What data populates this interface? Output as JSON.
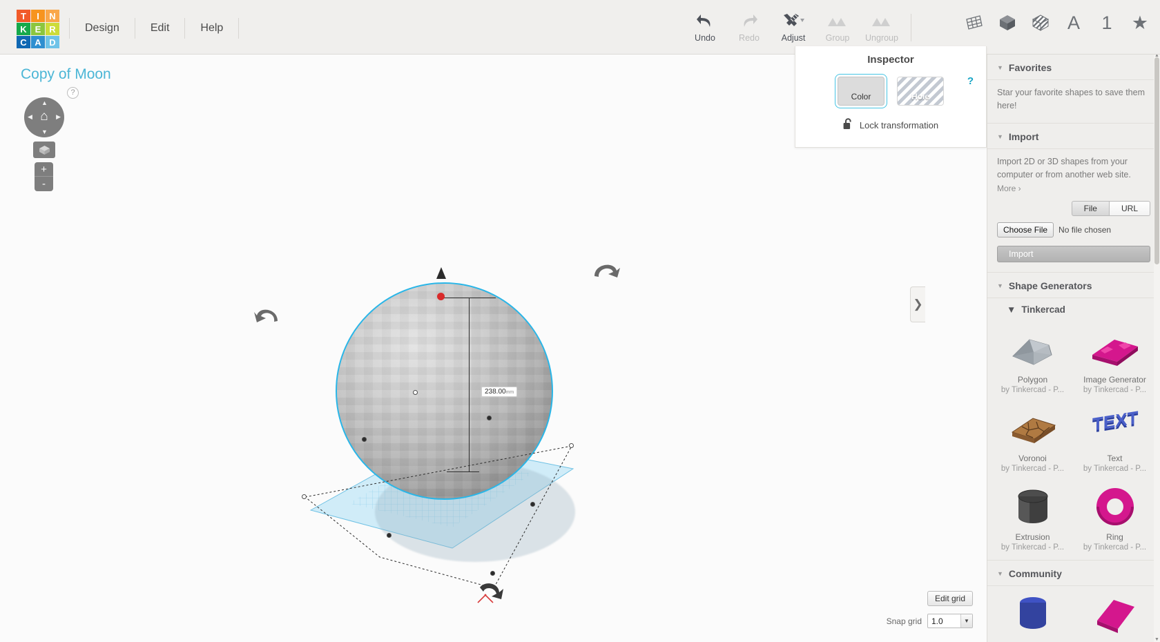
{
  "app": {
    "logo_letters": [
      {
        "ch": "T",
        "color": "#f15a29"
      },
      {
        "ch": "I",
        "color": "#f7941e"
      },
      {
        "ch": "N",
        "color": "#faa74a"
      },
      {
        "ch": "K",
        "color": "#16a94b"
      },
      {
        "ch": "E",
        "color": "#8cc63e"
      },
      {
        "ch": "R",
        "color": "#cddc39"
      },
      {
        "ch": "C",
        "color": "#1068b3"
      },
      {
        "ch": "A",
        "color": "#2f8fd0"
      },
      {
        "ch": "D",
        "color": "#6fc3e8"
      }
    ],
    "menu": [
      "Design",
      "Edit",
      "Help"
    ]
  },
  "toolbar": {
    "tools": [
      {
        "label": "Undo",
        "icon": "undo-icon",
        "disabled": false
      },
      {
        "label": "Redo",
        "icon": "redo-icon",
        "disabled": true
      },
      {
        "label": "Adjust",
        "icon": "adjust-icon",
        "disabled": false
      },
      {
        "label": "Group",
        "icon": "group-icon",
        "disabled": true
      },
      {
        "label": "Ungroup",
        "icon": "ungroup-icon",
        "disabled": true
      }
    ],
    "right_icons": [
      {
        "name": "workplane-icon",
        "glyph": ""
      },
      {
        "name": "solid-cube-icon",
        "glyph": ""
      },
      {
        "name": "hole-cube-icon",
        "glyph": ""
      },
      {
        "name": "text-a-icon",
        "glyph": "A"
      },
      {
        "name": "number-one-icon",
        "glyph": "1"
      },
      {
        "name": "favorites-star-icon",
        "glyph": "★"
      }
    ]
  },
  "canvas": {
    "document_title": "Copy of Moon",
    "nav": {
      "help_glyph": "?",
      "home_glyph": "⌂",
      "up": "▲",
      "down": "▼",
      "left": "◀",
      "right": "▶",
      "zoom_in": "+",
      "zoom_out": "-"
    },
    "dimension": {
      "value": "238.00",
      "unit": "mm"
    },
    "edit_grid_label": "Edit grid",
    "snap_grid_label": "Snap grid",
    "snap_grid_value": "1.0",
    "panel_tab_glyph": "❯",
    "accent_color": "#29b6e8"
  },
  "inspector": {
    "title": "Inspector",
    "color_label": "Color",
    "hole_label": "Hole",
    "help_glyph": "?",
    "lock_label": "Lock transformation",
    "selected": "Color"
  },
  "sidebar": {
    "sections": [
      {
        "name": "favorites",
        "title": "Favorites",
        "body": "Star your favorite shapes to save them here!"
      },
      {
        "name": "import",
        "title": "Import",
        "body": "Import 2D or 3D shapes from your computer or from another web site.",
        "more_label": "More ›",
        "tabs": [
          {
            "label": "File",
            "selected": true
          },
          {
            "label": "URL",
            "selected": false
          }
        ],
        "choose_file_label": "Choose File",
        "no_file_label": "No file chosen",
        "import_button_label": "Import"
      },
      {
        "name": "shape-generators",
        "title": "Shape Generators",
        "subsection": "Tinkercad",
        "shapes": [
          {
            "name": "Polygon",
            "by": "by Tinkercad - P...",
            "thumb": "polygon-thumb"
          },
          {
            "name": "Image Generator",
            "by": "by Tinkercad - P...",
            "thumb": "image-generator-thumb"
          },
          {
            "name": "Voronoi",
            "by": "by Tinkercad - P...",
            "thumb": "voronoi-thumb"
          },
          {
            "name": "Text",
            "by": "by Tinkercad - P...",
            "thumb": "text-thumb"
          },
          {
            "name": "Extrusion",
            "by": "by Tinkercad - P...",
            "thumb": "extrusion-thumb"
          },
          {
            "name": "Ring",
            "by": "by Tinkercad - P...",
            "thumb": "ring-thumb"
          }
        ]
      },
      {
        "name": "community",
        "title": "Community"
      }
    ]
  }
}
